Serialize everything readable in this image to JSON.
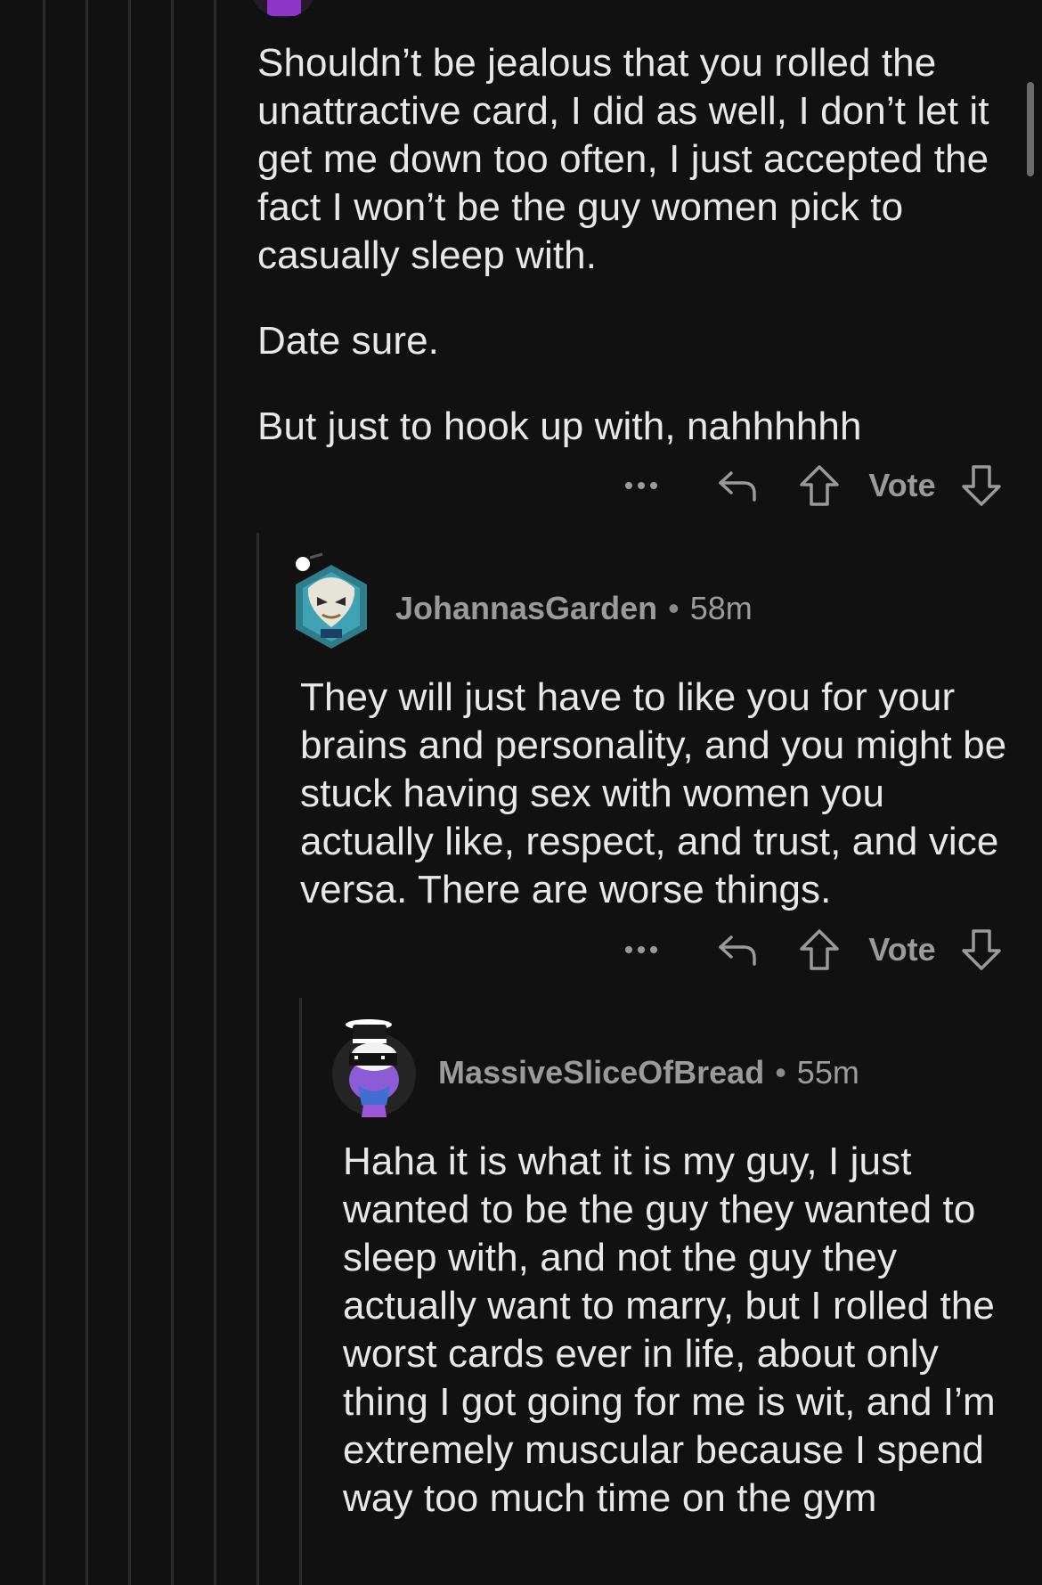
{
  "comments": [
    {
      "paragraphs": [
        "Shouldn’t be jealous that you rolled the unattractive card, I did as well, I don’t let it get me down too often, I just accepted the fact I won’t be the guy women pick to casually sleep with.",
        "Date sure.",
        "But just to hook up with, nahhhhhh"
      ],
      "actions": {
        "more": "•••",
        "vote": "Vote"
      }
    },
    {
      "author": "JohannasGarden",
      "separator": "•",
      "time": "58m",
      "body": "They will just have to like you for your brains and personality, and you might be stuck having sex with women you actually like, respect, and trust, and vice versa. There are worse things.",
      "actions": {
        "more": "•••",
        "vote": "Vote"
      }
    },
    {
      "author": "MassiveSliceOfBread",
      "separator": "•",
      "time": "55m",
      "body": "Haha it is what it is my guy, I just wanted to be the guy they wanted to sleep with, and not the guy they actually want to marry, but I rolled the worst cards ever in life, about only thing I got going for me is wit, and I’m extremely muscular because I spend way too much time on the gym"
    }
  ],
  "icons": {
    "more": "more-options-icon",
    "reply": "reply-icon",
    "upvote": "upvote-icon",
    "downvote": "downvote-icon"
  }
}
